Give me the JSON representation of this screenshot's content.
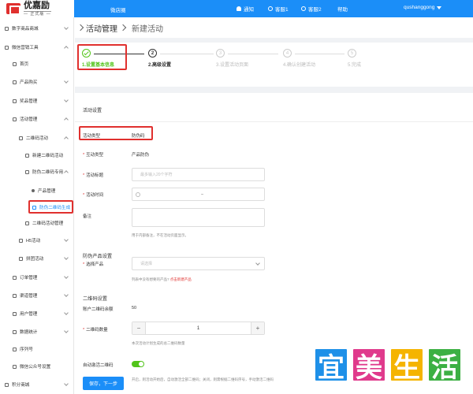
{
  "header": {
    "logo_name": "优嘉励",
    "logo_sub": "— 正式版 —",
    "title": "微店圈",
    "notify": "通知",
    "cs1": "客服1",
    "cs2": "客服2",
    "help": "帮助",
    "user": "qushanggong"
  },
  "sidebar": {
    "items": [
      {
        "label": "数字商品商城",
        "icon": "store-icon"
      },
      {
        "label": "微信营销工具",
        "icon": "wechat-icon"
      },
      {
        "label": "首页",
        "icon": "home-icon"
      },
      {
        "label": "产品购买",
        "icon": "cart-icon"
      },
      {
        "label": "奖品管理",
        "icon": "gift-icon"
      },
      {
        "label": "活动管理",
        "icon": "flag-icon"
      },
      {
        "label": "二维码活动",
        "icon": "qrcode-icon"
      },
      {
        "label": "新建二维码活动",
        "icon": "qrcode-add-icon"
      },
      {
        "label": "防伪二维码专用",
        "icon": "shield-icon"
      },
      {
        "label": "产品管理",
        "icon": "dot-icon"
      },
      {
        "label": "防伪二维码生成",
        "icon": "qrcode-icon"
      },
      {
        "label": "二维码活动管理",
        "icon": "qrcode-icon"
      },
      {
        "label": "H5活动",
        "icon": "h5-icon"
      },
      {
        "label": "拼团活动",
        "icon": "group-icon"
      },
      {
        "label": "订单管理",
        "icon": "order-icon"
      },
      {
        "label": "渠道管理",
        "icon": "channel-icon"
      },
      {
        "label": "用户管理",
        "icon": "user-icon"
      },
      {
        "label": "数据统计",
        "icon": "chart-icon"
      },
      {
        "label": "序列号",
        "icon": "serial-icon"
      },
      {
        "label": "微信公众号设置",
        "icon": "wechat-icon"
      },
      {
        "label": "积分商城",
        "icon": "points-icon"
      }
    ]
  },
  "breadcrumb": {
    "parent": "活动管理",
    "current": "新建活动"
  },
  "steps": [
    {
      "num": "1",
      "label": "1.设置基本信息"
    },
    {
      "num": "2",
      "label": "2.高级设置"
    },
    {
      "num": "3",
      "label": "3.设置活动页面"
    },
    {
      "num": "4",
      "label": "4.确认创建活动"
    },
    {
      "num": "5",
      "label": "5.完成"
    }
  ],
  "form": {
    "section_title": "活动设置",
    "type_label": "活动类型",
    "type_value": "防伪码",
    "interact_label": "互动类型",
    "interact_value": "产品防伪",
    "title_label": "活动标题",
    "title_placeholder": "最多输入20个字符",
    "time_label": "活动时间",
    "time_sep": "–",
    "remark_label": "备注",
    "remark_hint": "用于内部备注，不在活动页面显示。",
    "product_group": "防伪产品设置",
    "product_label": "选择产品",
    "product_placeholder": "请选择",
    "product_hint": "列表中没有想要的产品?",
    "product_link": "点击新建产品",
    "qr_group": "二维码设置",
    "balance_label": "账户二维码余额",
    "balance_value": "50",
    "qty_label": "二维码数量",
    "qty_minus": "−",
    "qty_value": "1",
    "qty_plus": "+",
    "qty_hint": "本次活动计划生成的总二维码数量",
    "auto_label": "自动激活二维码",
    "auto_hint": "开启，则活动开始后，自动激活全部二维码；关闭，则需根据二维码序号，手动激活二维码",
    "submit": "保存，下一步"
  },
  "watermark": [
    "宜",
    "美",
    "生",
    "活"
  ],
  "colors": {
    "primary": "#1b8ef8",
    "success": "#52c41a",
    "highlight": "#e0302e"
  }
}
